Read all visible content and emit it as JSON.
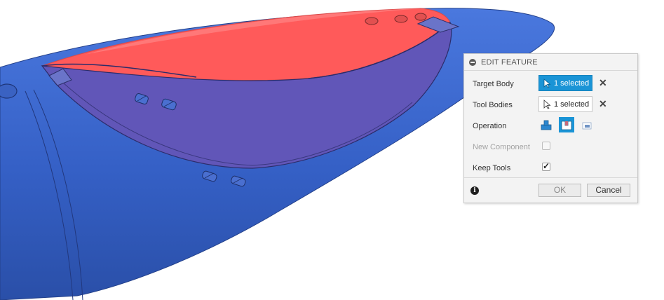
{
  "panel": {
    "title": "EDIT FEATURE",
    "target_body": {
      "label": "Target Body",
      "value": "1 selected"
    },
    "tool_bodies": {
      "label": "Tool Bodies",
      "value": "1 selected"
    },
    "operation": {
      "label": "Operation",
      "options": [
        "join-icon",
        "cut-icon",
        "intersect-icon"
      ],
      "selected": "cut-icon"
    },
    "new_component": {
      "label": "New Component",
      "checked": false
    },
    "keep_tools": {
      "label": "Keep Tools",
      "checked": true
    },
    "ok_label": "OK",
    "cancel_label": "Cancel"
  },
  "colors": {
    "accent": "#1a94d6",
    "body_blue": "#3a64c8",
    "tool_red": "#ff5454"
  }
}
